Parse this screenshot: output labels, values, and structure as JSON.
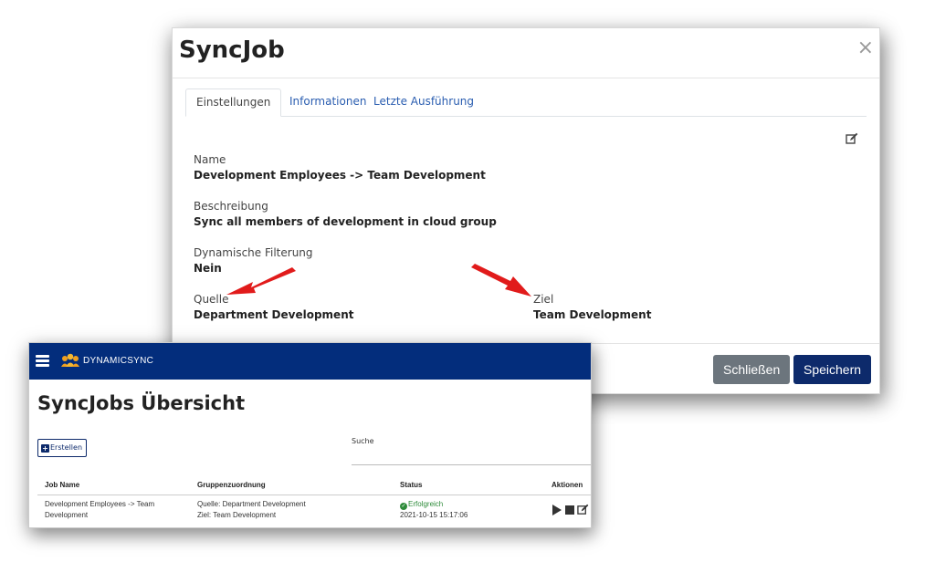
{
  "modal": {
    "title": "SyncJob",
    "close_symbol": "×",
    "tabs": [
      {
        "label": "Einstellungen"
      },
      {
        "label": "Informationen"
      },
      {
        "label": "Letzte Ausführung"
      }
    ],
    "edit_icon": "edit-icon",
    "fields": {
      "name_label": "Name",
      "name_value": "Development Employees -> Team Development",
      "description_label": "Beschreibung",
      "description_value": "Sync all members of development in cloud group",
      "dynamic_filter_label": "Dynamische Filterung",
      "dynamic_filter_value": "Nein",
      "source_label": "Quelle",
      "source_value": "Department Development",
      "target_label": "Ziel",
      "target_value": "Team Development"
    },
    "buttons": {
      "close_label": "Schließen",
      "save_label": "Speichern"
    }
  },
  "app": {
    "brand": "DYNAMICSYNC",
    "page_title": "SyncJobs Übersicht",
    "create_label": "Erstellen",
    "search_label": "Suche",
    "search_value": "",
    "table": {
      "headers": {
        "job_name": "Job Name",
        "group_assignment": "Gruppenzuordnung",
        "status": "Status",
        "actions": "Aktionen"
      },
      "rows": [
        {
          "job_name_line1": "Development Employees -> Team",
          "job_name_line2": "Development",
          "source": "Quelle: Department Development",
          "target": "Ziel: Team Development",
          "status": "Erfolgreich",
          "timestamp": "2021-10-15 15:17:06"
        }
      ]
    }
  },
  "colors": {
    "navbar": "#032d7c",
    "primary_button": "#0d2a6b",
    "secondary_button": "#6c757d",
    "success": "#2e8b3a",
    "arrow": "#e11b1b",
    "tab_link": "#2a5db0"
  }
}
